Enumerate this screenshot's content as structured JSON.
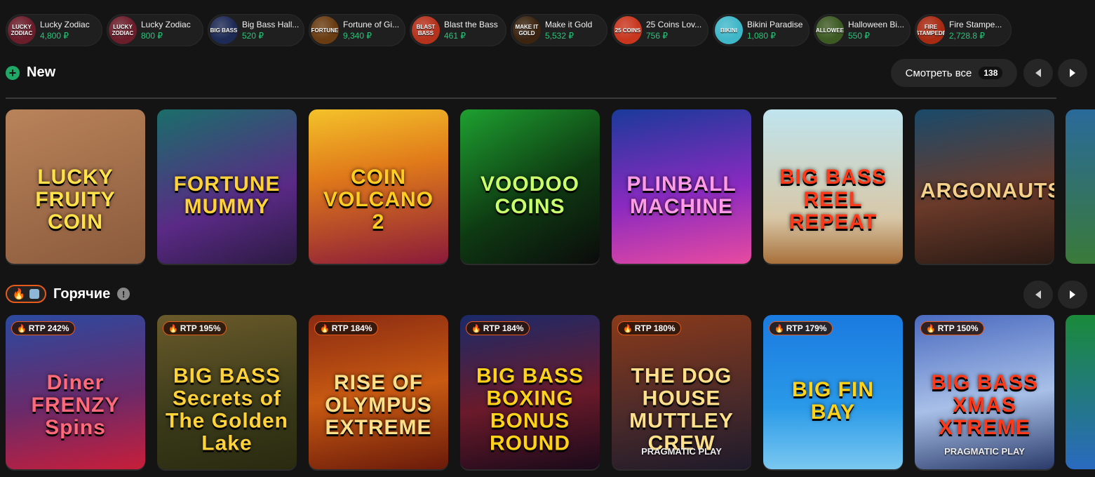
{
  "ticker": [
    {
      "name": "Lucky Zodiac",
      "amount": "4,800 ₽",
      "bg": "#6b1d2a",
      "art": "LUCKY ZODIAC"
    },
    {
      "name": "Lucky Zodiac",
      "amount": "800 ₽",
      "bg": "#6b1d2a",
      "art": "LUCKY ZODIAC"
    },
    {
      "name": "Big Bass Hall...",
      "amount": "520 ₽",
      "bg": "#1d2a55",
      "art": "BIG BASS"
    },
    {
      "name": "Fortune of Gi...",
      "amount": "9,340 ₽",
      "bg": "#6a3c12",
      "art": "FORTUNE"
    },
    {
      "name": "Blast the Bass",
      "amount": "461 ₽",
      "bg": "#b5321c",
      "art": "BLAST BASS"
    },
    {
      "name": "Make it Gold",
      "amount": "5,532 ₽",
      "bg": "#3b2410",
      "art": "MAKE IT GOLD"
    },
    {
      "name": "25 Coins Lov...",
      "amount": "756 ₽",
      "bg": "#c8361e",
      "art": "25 COINS"
    },
    {
      "name": "Bikini Paradise",
      "amount": "1,080 ₽",
      "bg": "#3fb7c9",
      "art": "BIKINI"
    },
    {
      "name": "Halloween Bi...",
      "amount": "550 ₽",
      "bg": "#3d5a23",
      "art": "HALLOWEEN"
    },
    {
      "name": "Fire Stampe...",
      "amount": "2,728.8 ₽",
      "bg": "#a82a12",
      "art": "FIRE STAMPEDE"
    }
  ],
  "new_section": {
    "title": "New",
    "see_all_label": "Смотреть все",
    "see_all_count": "138",
    "cards": [
      {
        "art": "LUCKY FRUITY COIN",
        "bg": "linear-gradient(160deg,#b9835a,#8a5a3c)",
        "color": "#ffe14a"
      },
      {
        "art": "FORTUNE MUMMY",
        "bg": "linear-gradient(160deg,#1a6e6a,#5a2a86 60%,#2a1a40)",
        "color": "#ffd23a"
      },
      {
        "art": "COIN VOLCANO 2",
        "bg": "linear-gradient(170deg,#f4c22a,#e07a1a 40%,#8a1a3a)",
        "color": "#ffcc22"
      },
      {
        "art": "VOODOO COINS",
        "bg": "linear-gradient(150deg,#1ea030,#0e3a12 55%,#0b0b0b)",
        "color": "#c8ff6a"
      },
      {
        "art": "PLINBALL MACHINE",
        "bg": "linear-gradient(170deg,#1a3a9a,#8a2ac0 55%,#e84aa0)",
        "color": "#ff9ae6"
      },
      {
        "art": "BIG BASS REEL REPEAT",
        "bg": "linear-gradient(180deg,#bfe4ee,#d8c8a8 70%,#a8703a)",
        "color": "#ff3a1a"
      },
      {
        "art": "ARGONAUTS",
        "bg": "linear-gradient(170deg,#1a4a6a,#6a3a2a 55%,#2a1a14)",
        "color": "#f4d08a"
      }
    ],
    "edge_bg": "linear-gradient(180deg,#2a6a9a,#3a7a3a)"
  },
  "hot_section": {
    "title": "Горячие",
    "cards": [
      {
        "art": "Diner FRENZY Spins",
        "rtp": "RTP 242%",
        "bg": "linear-gradient(170deg,#2a4aa0,#6a2a6a 55%,#c81e3a)",
        "color": "#ff6a7a",
        "sub": ""
      },
      {
        "art": "BIG BASS Secrets of The Golden Lake",
        "rtp": "RTP 195%",
        "bg": "linear-gradient(170deg,#6a5a2a,#3a3a1a 60%,#2a2a10)",
        "color": "#ffd23a",
        "sub": ""
      },
      {
        "art": "RISE OF OLYMPUS EXTREME",
        "rtp": "RTP 184%",
        "bg": "linear-gradient(170deg,#8a2a12,#c85a12 50%,#6a1a0a)",
        "color": "#ffe08a",
        "sub": ""
      },
      {
        "art": "BIG BASS BOXING BONUS ROUND",
        "rtp": "RTP 184%",
        "bg": "linear-gradient(170deg,#1a2a6a,#6a1a2a 55%,#1a0a1a)",
        "color": "#ffd21a",
        "sub": ""
      },
      {
        "art": "THE DOG HOUSE MUTTLEY CREW",
        "rtp": "RTP 180%",
        "bg": "linear-gradient(170deg,#8a3a1a,#4a2a2a 60%,#1e1a2a)",
        "color": "#ffe08a",
        "sub": "PRAGMATIC PLAY"
      },
      {
        "art": "BIG FIN BAY",
        "rtp": "RTP 179%",
        "bg": "linear-gradient(180deg,#1a7ae0,#2a9ae8 60%,#7ac8f0)",
        "color": "#ffd21a",
        "sub": ""
      },
      {
        "art": "BIG BASS XMAS XTREME",
        "rtp": "RTP 150%",
        "bg": "linear-gradient(170deg,#4a6ac0,#a8c0e8 55%,#2a3a6a)",
        "color": "#ff3a1a",
        "sub": "PRAGMATIC PLAY"
      }
    ],
    "edge_bg": "linear-gradient(180deg,#1a8a3a,#2a6ac0)"
  },
  "icons": {
    "plus": "plus-circle-icon",
    "prev": "chevron-left-icon",
    "next": "chevron-right-icon",
    "fire": "fire-icon",
    "ice": "ice-icon",
    "info": "info-icon"
  },
  "colors": {
    "accent_green": "#1fa866",
    "amount_green": "#2fc27a",
    "hot_orange": "#e65a1a",
    "bg": "#141414"
  }
}
